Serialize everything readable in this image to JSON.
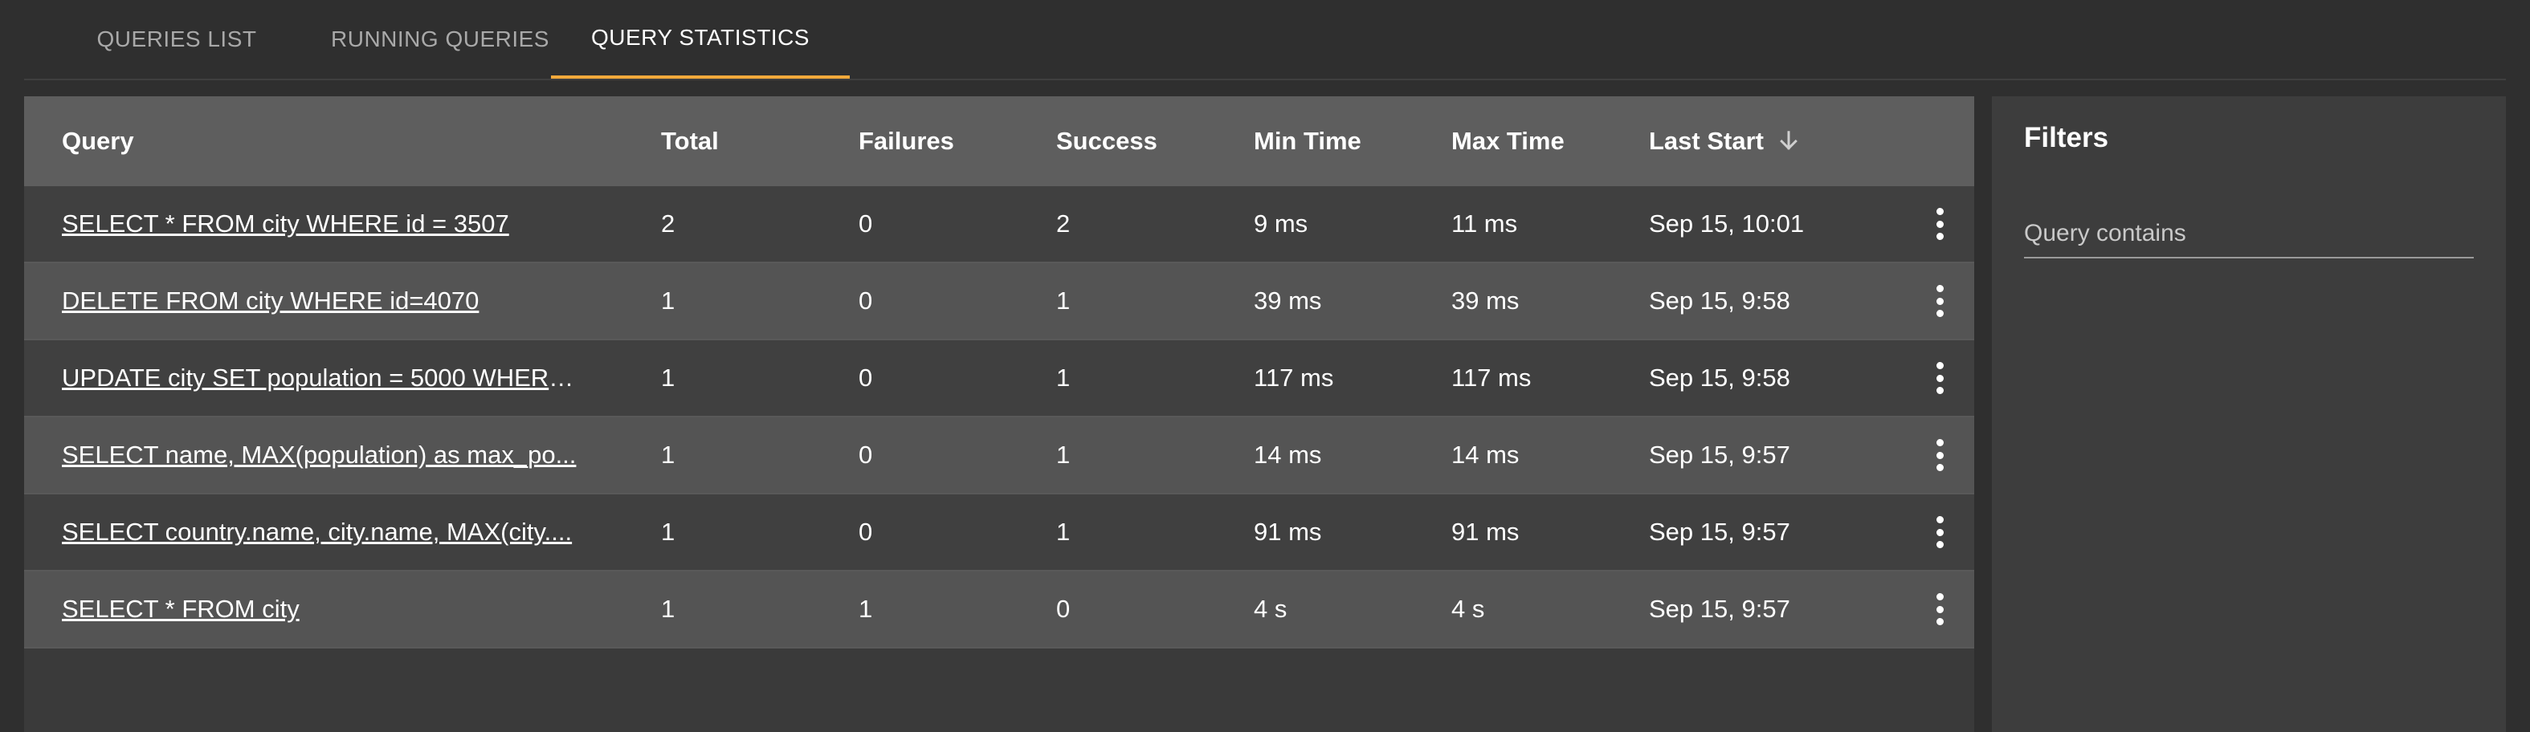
{
  "tabs": [
    {
      "label": "QUERIES LIST",
      "active": false
    },
    {
      "label": "RUNNING QUERIES",
      "active": false
    },
    {
      "label": "QUERY STATISTICS",
      "active": true
    }
  ],
  "colors": {
    "accent": "#f2a93b",
    "background": "#2f2f2f",
    "header_bg": "#5e5e5e"
  },
  "table": {
    "headers": {
      "query": "Query",
      "total": "Total",
      "failures": "Failures",
      "success": "Success",
      "min_time": "Min Time",
      "max_time": "Max Time",
      "last_start": "Last Start"
    },
    "sort": {
      "column": "last_start",
      "direction": "descending",
      "icon": "arrow-down-icon"
    },
    "rows": [
      {
        "query": "SELECT * FROM city WHERE id = 3507",
        "total": "2",
        "failures": "0",
        "success": "2",
        "min_time": "9 ms",
        "max_time": "11 ms",
        "last_start": "Sep 15, 10:01"
      },
      {
        "query": "DELETE FROM city WHERE id=4070",
        "total": "1",
        "failures": "0",
        "success": "1",
        "min_time": "39 ms",
        "max_time": "39 ms",
        "last_start": "Sep 15, 9:58"
      },
      {
        "query": "UPDATE city SET population = 5000 WHERE ...",
        "total": "1",
        "failures": "0",
        "success": "1",
        "min_time": "117 ms",
        "max_time": "117 ms",
        "last_start": "Sep 15, 9:58"
      },
      {
        "query": "SELECT name, MAX(population) as max_po...",
        "total": "1",
        "failures": "0",
        "success": "1",
        "min_time": "14 ms",
        "max_time": "14 ms",
        "last_start": "Sep 15, 9:57"
      },
      {
        "query": "SELECT country.name, city.name, MAX(city....",
        "total": "1",
        "failures": "0",
        "success": "1",
        "min_time": "91 ms",
        "max_time": "91 ms",
        "last_start": "Sep 15, 9:57"
      },
      {
        "query": "SELECT * FROM city",
        "total": "1",
        "failures": "1",
        "success": "0",
        "min_time": "4 s",
        "max_time": "4 s",
        "last_start": "Sep 15, 9:57"
      }
    ],
    "row_action_icon": "more-vertical-icon"
  },
  "filters": {
    "title": "Filters",
    "query_contains": {
      "placeholder": "Query contains",
      "value": ""
    }
  }
}
